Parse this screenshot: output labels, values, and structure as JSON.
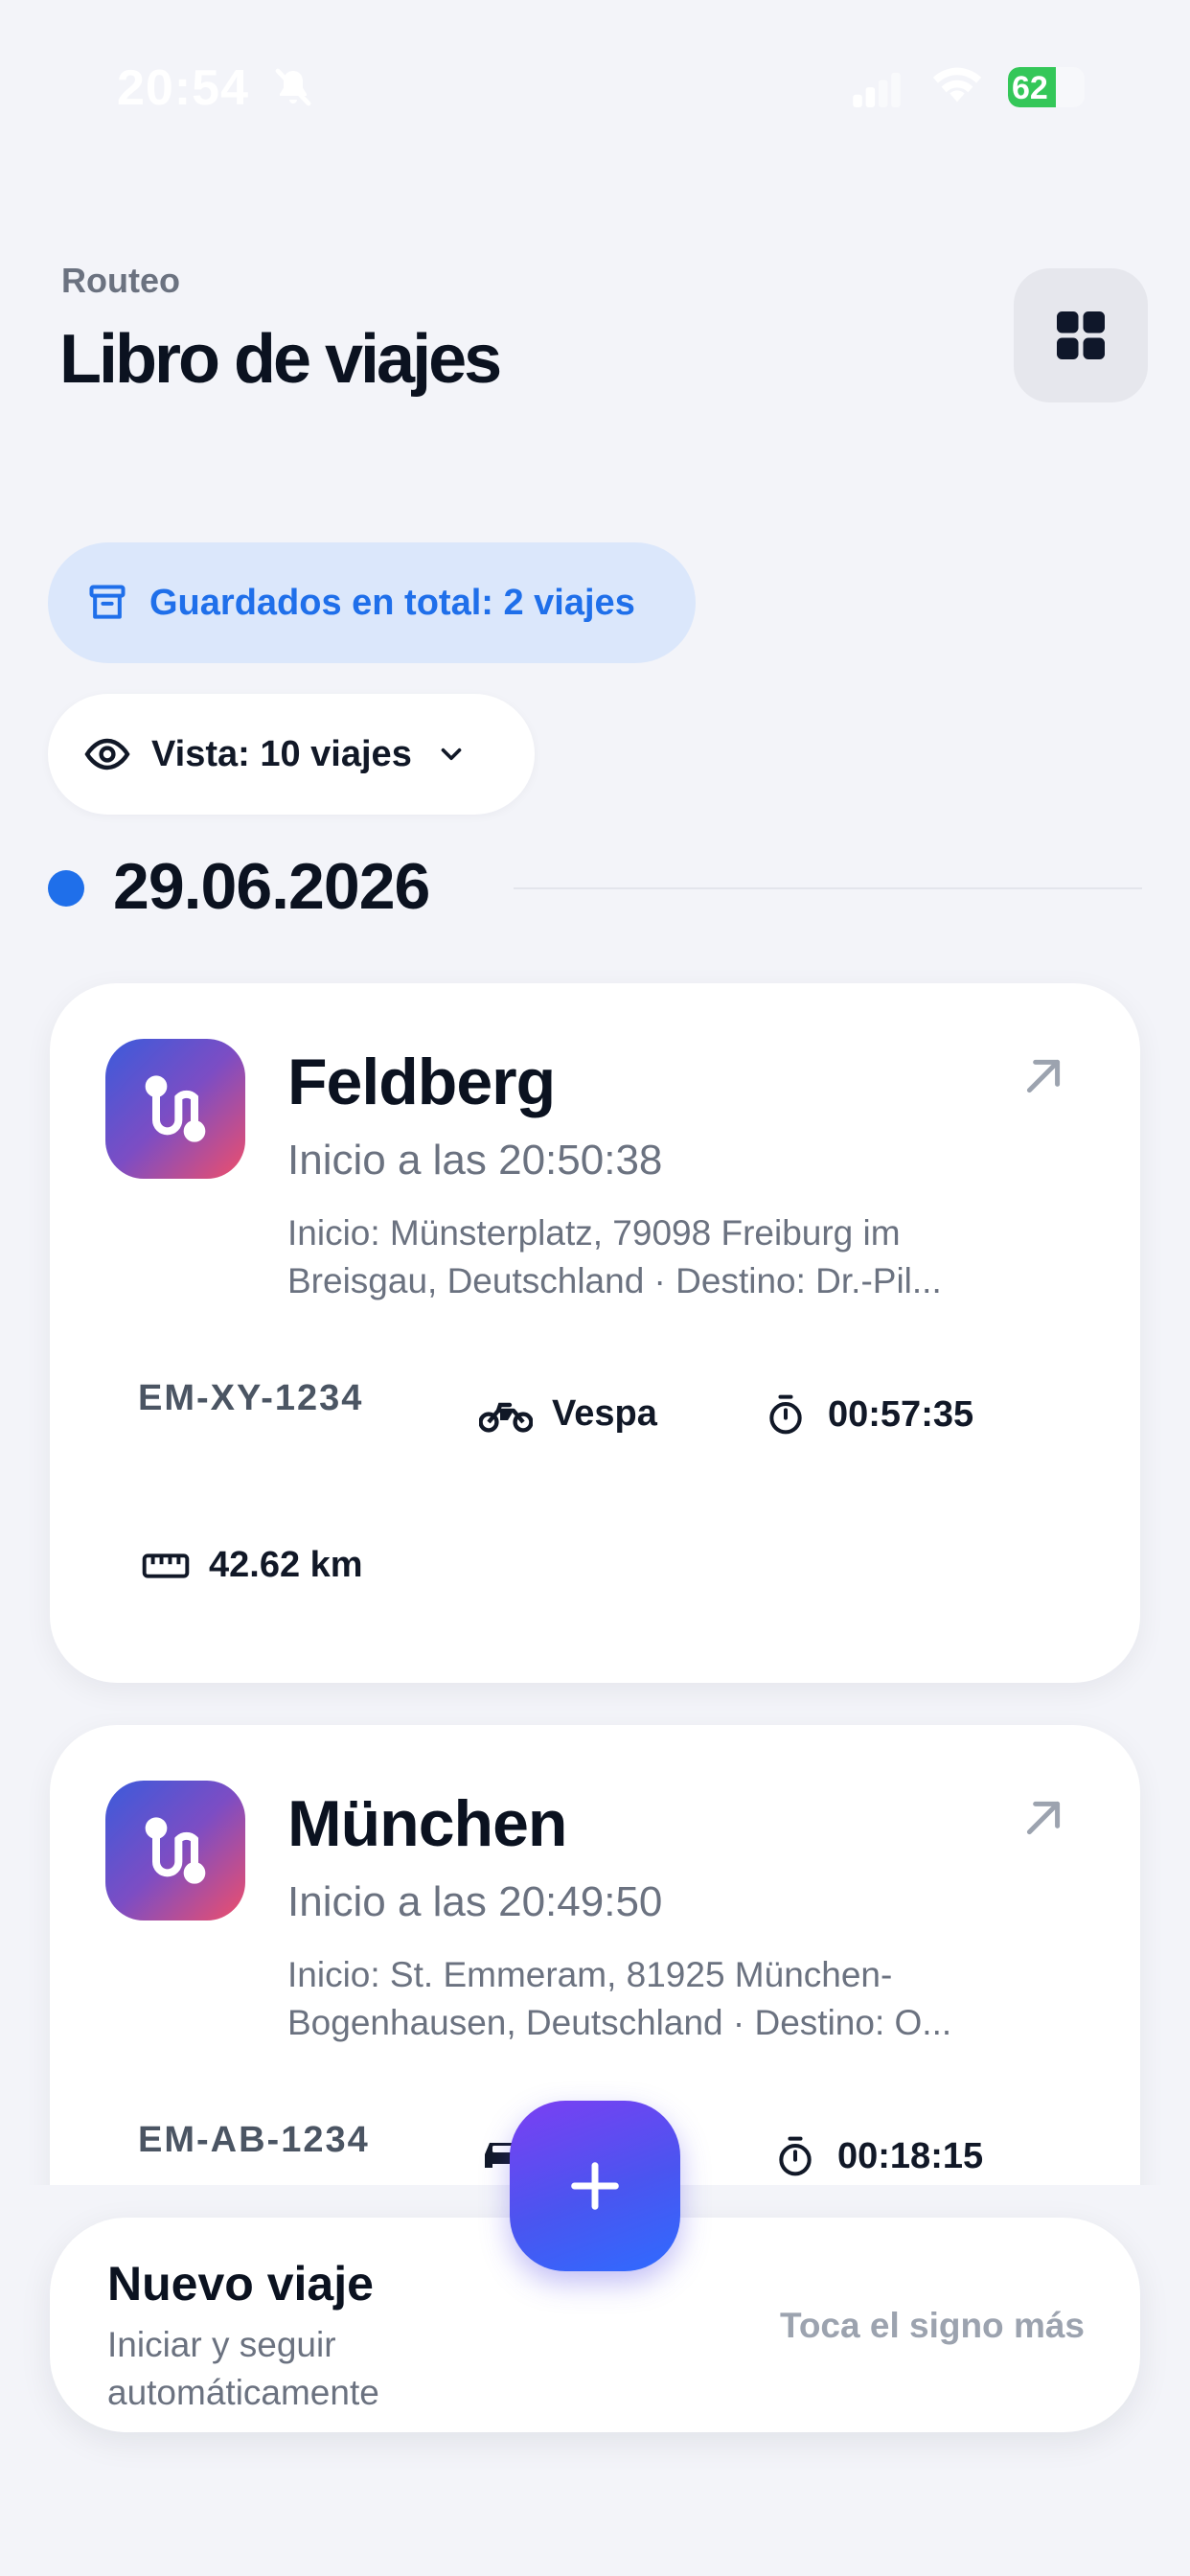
{
  "status_bar": {
    "time": "20:54",
    "battery_text": "62",
    "battery_level": 0.62
  },
  "header": {
    "app_name": "Routeo",
    "title": "Libro de viajes"
  },
  "summary": {
    "saved_label": "Guardados en total: 2 viajes",
    "view_label": "Vista: 10 viajes"
  },
  "date_group": {
    "date": "29.06.2026"
  },
  "trips": [
    {
      "title": "Feldberg",
      "start_time": "Inicio a las 20:50:38",
      "address": "Inicio: Münsterplatz, 79098 Freiburg im Breisgau, Deutschland · Destino: Dr.-Pil...",
      "plate": "EM-XY-1234",
      "vehicle": "Vespa",
      "duration": "00:57:35",
      "distance": "42.62 km"
    },
    {
      "title": "München",
      "start_time": "Inicio a las 20:49:50",
      "address": "Inicio: St. Emmeram, 81925 München-Bogenhausen, Deutschland · Destino: O...",
      "plate": "EM-AB-1234",
      "duration": "00:18:15"
    }
  ],
  "new_trip": {
    "title": "Nuevo viaje",
    "subtitle": "Iniciar y seguir automáticamente",
    "hint": "Toca el signo más"
  },
  "icons": {
    "bell": "bell-slash-icon",
    "signal": "cellular-signal-icon",
    "wifi": "wifi-icon",
    "grid": "grid-icon",
    "archive": "archive-box-icon",
    "eye": "eye-icon",
    "chevron": "chevron-down-icon",
    "route": "route-icon",
    "open": "arrow-up-right-icon",
    "motorbike": "motorcycle-icon",
    "car": "car-icon",
    "timer": "stopwatch-icon",
    "ruler": "ruler-icon",
    "plus": "plus-icon"
  },
  "colors": {
    "accent": "#1f6fea",
    "saved_chip_bg": "#dbe7fb",
    "battery_green": "#34c759",
    "fab_start": "#7b3ff2",
    "fab_end": "#2f6bff",
    "background": "#f3f4f9"
  }
}
